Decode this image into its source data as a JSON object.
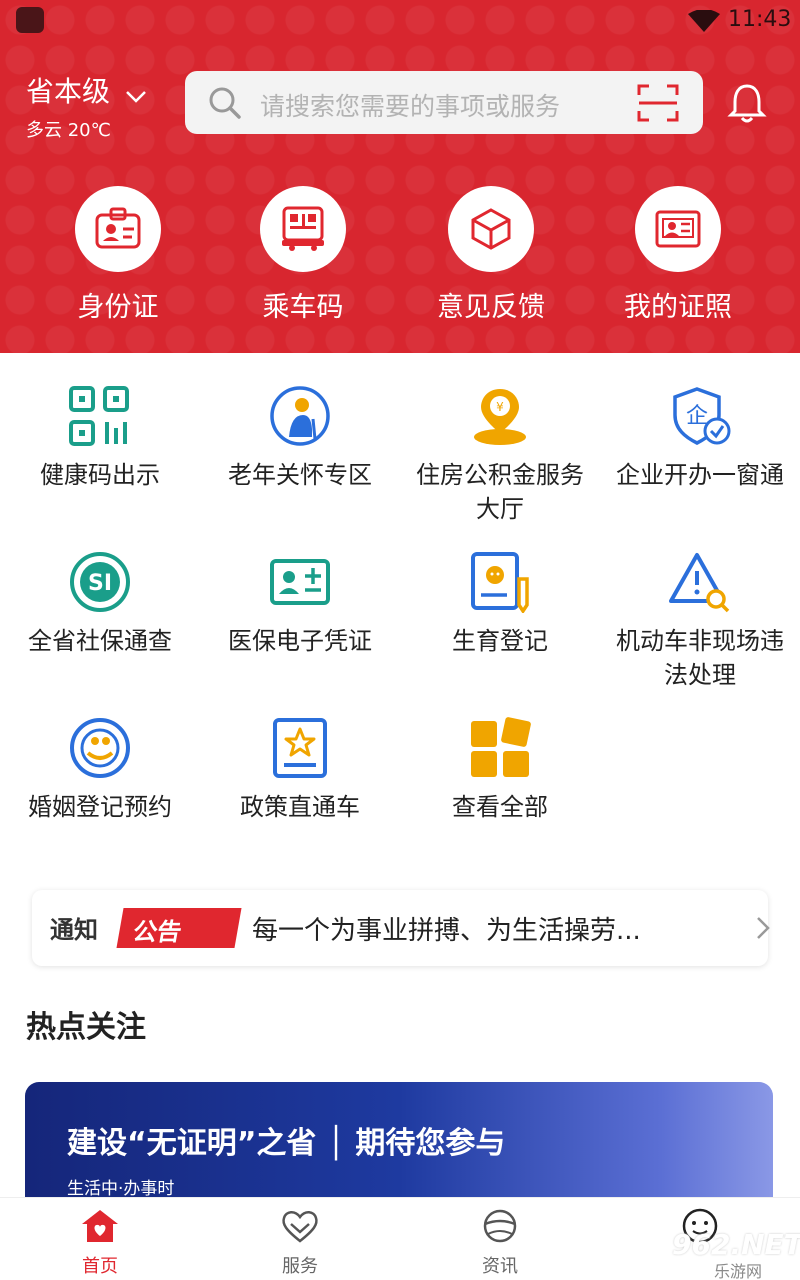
{
  "status": {
    "time": "11:43"
  },
  "header": {
    "region": "省本级",
    "weather": "多云 20℃",
    "search_placeholder": "请搜索您需要的事项或服务"
  },
  "quick_actions": [
    {
      "label": "身份证",
      "icon": "id-card-icon"
    },
    {
      "label": "乘车码",
      "icon": "bus-code-icon"
    },
    {
      "label": "意见反馈",
      "icon": "feedback-box-icon"
    },
    {
      "label": "我的证照",
      "icon": "license-icon"
    }
  ],
  "services": [
    {
      "label": "健康码出示",
      "icon": "qr-code-icon",
      "color": "#1a9e8a"
    },
    {
      "label": "老年关怀专区",
      "icon": "elderly-icon",
      "color": "#2b6fdb"
    },
    {
      "label": "住房公积金服务大厅",
      "icon": "housing-fund-icon",
      "color": "#f0a500"
    },
    {
      "label": "企业开办一窗通",
      "icon": "enterprise-shield-icon",
      "color": "#2b6fdb"
    },
    {
      "label": "全省社保通查",
      "icon": "social-security-icon",
      "color": "#1a9e8a"
    },
    {
      "label": "医保电子凭证",
      "icon": "medical-card-icon",
      "color": "#1a9e8a"
    },
    {
      "label": "生育登记",
      "icon": "birth-registration-icon",
      "color": "#2b6fdb"
    },
    {
      "label": "机动车非现场违法处理",
      "icon": "traffic-warning-icon",
      "color": "#2b6fdb"
    },
    {
      "label": "婚姻登记预约",
      "icon": "marriage-icon",
      "color": "#2b6fdb"
    },
    {
      "label": "政策直通车",
      "icon": "policy-book-icon",
      "color": "#2b6fdb"
    },
    {
      "label": "查看全部",
      "icon": "all-grid-icon",
      "color": "#f0a500"
    }
  ],
  "notice": {
    "tag_left": "通知",
    "tag_right": "公告",
    "text": "每一个为事业拼搏、为生活操劳..."
  },
  "hot": {
    "title": "热点关注",
    "banner_title": "建设“无证明”之省 │ 期待您参与",
    "banner_sub": "生活中·办事时"
  },
  "tabs": [
    {
      "label": "首页",
      "active": true
    },
    {
      "label": "服务",
      "active": false
    },
    {
      "label": "资讯",
      "active": false
    },
    {
      "label": "",
      "active": false
    }
  ],
  "watermark": {
    "main": "962.NET",
    "sub": "乐游网"
  },
  "colors": {
    "brand_red": "#d8262f",
    "teal": "#1a9e8a",
    "blue": "#2b6fdb",
    "orange": "#f0a500"
  }
}
